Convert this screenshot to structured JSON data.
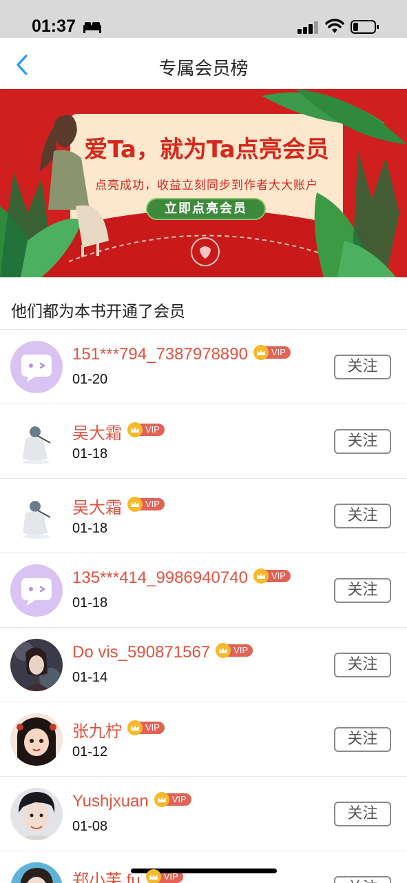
{
  "status_bar": {
    "time": "01:37"
  },
  "nav": {
    "title": "专属会员榜"
  },
  "banner": {
    "headline": "爱Ta，就为Ta点亮会员",
    "subtitle": "点亮成功，收益立刻同步到作者大大账户",
    "cta": "立即点亮会员"
  },
  "section": {
    "title": "他们都为本书开通了会员"
  },
  "vip_label": "VIP",
  "follow_label": "关注",
  "members": [
    {
      "name": "151***794_7387978890",
      "date": "01-20",
      "avatar": "chat-bubble"
    },
    {
      "name": "吴大霜",
      "date": "01-18",
      "avatar": "illustration"
    },
    {
      "name": "吴大霜",
      "date": "01-18",
      "avatar": "illustration"
    },
    {
      "name": "135***414_9986940740",
      "date": "01-18",
      "avatar": "chat-bubble"
    },
    {
      "name": "Do vis_590871567",
      "date": "01-14",
      "avatar": "photo"
    },
    {
      "name": "张九柠",
      "date": "01-12",
      "avatar": "cartoon-girl"
    },
    {
      "name": "Yushjxuan",
      "date": "01-08",
      "avatar": "photo"
    },
    {
      "name": "郑小芙 fu",
      "date": "",
      "avatar": "photo"
    }
  ],
  "colors": {
    "accent_name": "#e0533f",
    "banner_red": "#d01f1f",
    "vip_badge": "#e26256",
    "back_arrow": "#2a9df4"
  }
}
